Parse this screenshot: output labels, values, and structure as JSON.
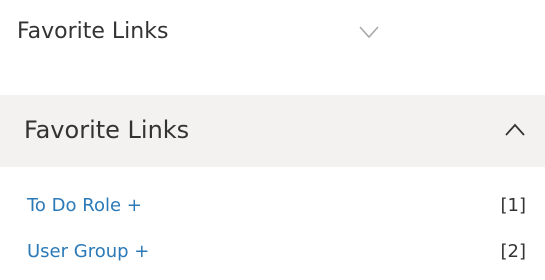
{
  "panels": {
    "collapsed": {
      "title": "Favorite Links",
      "toggle_icon": "chevron-down-icon"
    },
    "expanded": {
      "title": "Favorite Links",
      "toggle_icon": "chevron-up-icon"
    }
  },
  "favorite_links": [
    {
      "label": "To Do Role +",
      "count": "[1]"
    },
    {
      "label": "User Group +",
      "count": "[2]"
    }
  ],
  "colors": {
    "link": "#2a79b8",
    "text": "#333333",
    "header_bg": "#f3f2f0",
    "chevron_light": "#a9a9a9",
    "chevron_dark": "#333333"
  }
}
